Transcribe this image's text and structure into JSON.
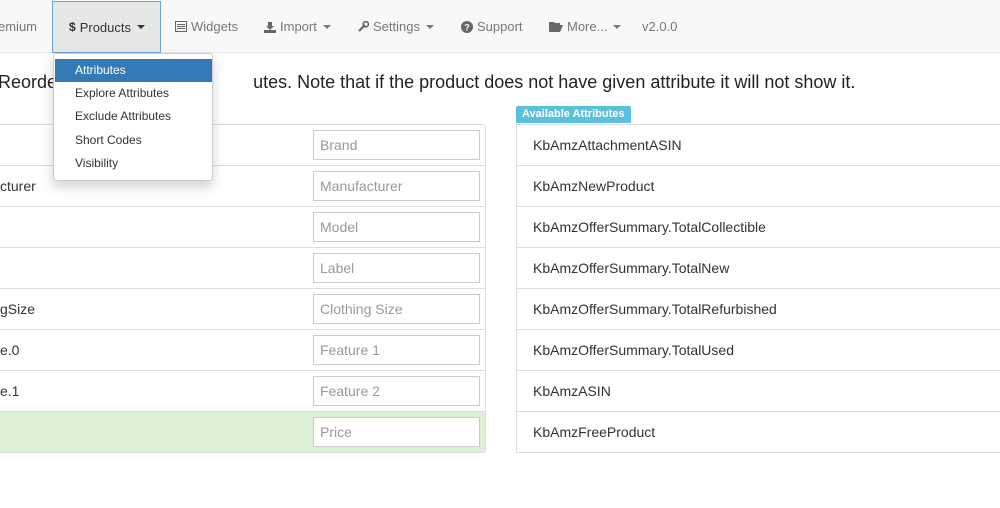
{
  "nav": {
    "premium": "emium",
    "products": "Products",
    "products_icon": "dollar-icon",
    "widgets": "Widgets",
    "import": "Import",
    "settings": "Settings",
    "support": "Support",
    "more": "More...",
    "version": "v2.0.0"
  },
  "dropdown": {
    "items": [
      {
        "label": "Attributes",
        "active": true
      },
      {
        "label": "Explore Attributes"
      },
      {
        "label": "Exclude Attributes"
      },
      {
        "label": "Short Codes"
      },
      {
        "label": "Visibility"
      }
    ]
  },
  "info_text": "Reorder                                      utes. Note that if the product does not have given attribute it will not show it.",
  "used_attributes": [
    {
      "name": "",
      "placeholder": "Brand"
    },
    {
      "name": "cturer",
      "placeholder": "Manufacturer"
    },
    {
      "name": "",
      "placeholder": "Model"
    },
    {
      "name": "",
      "placeholder": "Label"
    },
    {
      "name": "gSize",
      "placeholder": "Clothing Size"
    },
    {
      "name": "e.0",
      "placeholder": "Feature 1"
    },
    {
      "name": "e.1",
      "placeholder": "Feature 2"
    },
    {
      "name": "",
      "placeholder": "Price"
    }
  ],
  "available_label": "Available Attributes",
  "available_attributes": [
    "KbAmzAttachmentASIN",
    "KbAmzNewProduct",
    "KbAmzOfferSummary.TotalCollectible",
    "KbAmzOfferSummary.TotalNew",
    "KbAmzOfferSummary.TotalRefurbished",
    "KbAmzOfferSummary.TotalUsed",
    "KbAmzASIN",
    "KbAmzFreeProduct"
  ],
  "colors": {
    "accent": "#337ab7",
    "label_bg": "#5bc0de",
    "success_row": "#dff0d8"
  }
}
